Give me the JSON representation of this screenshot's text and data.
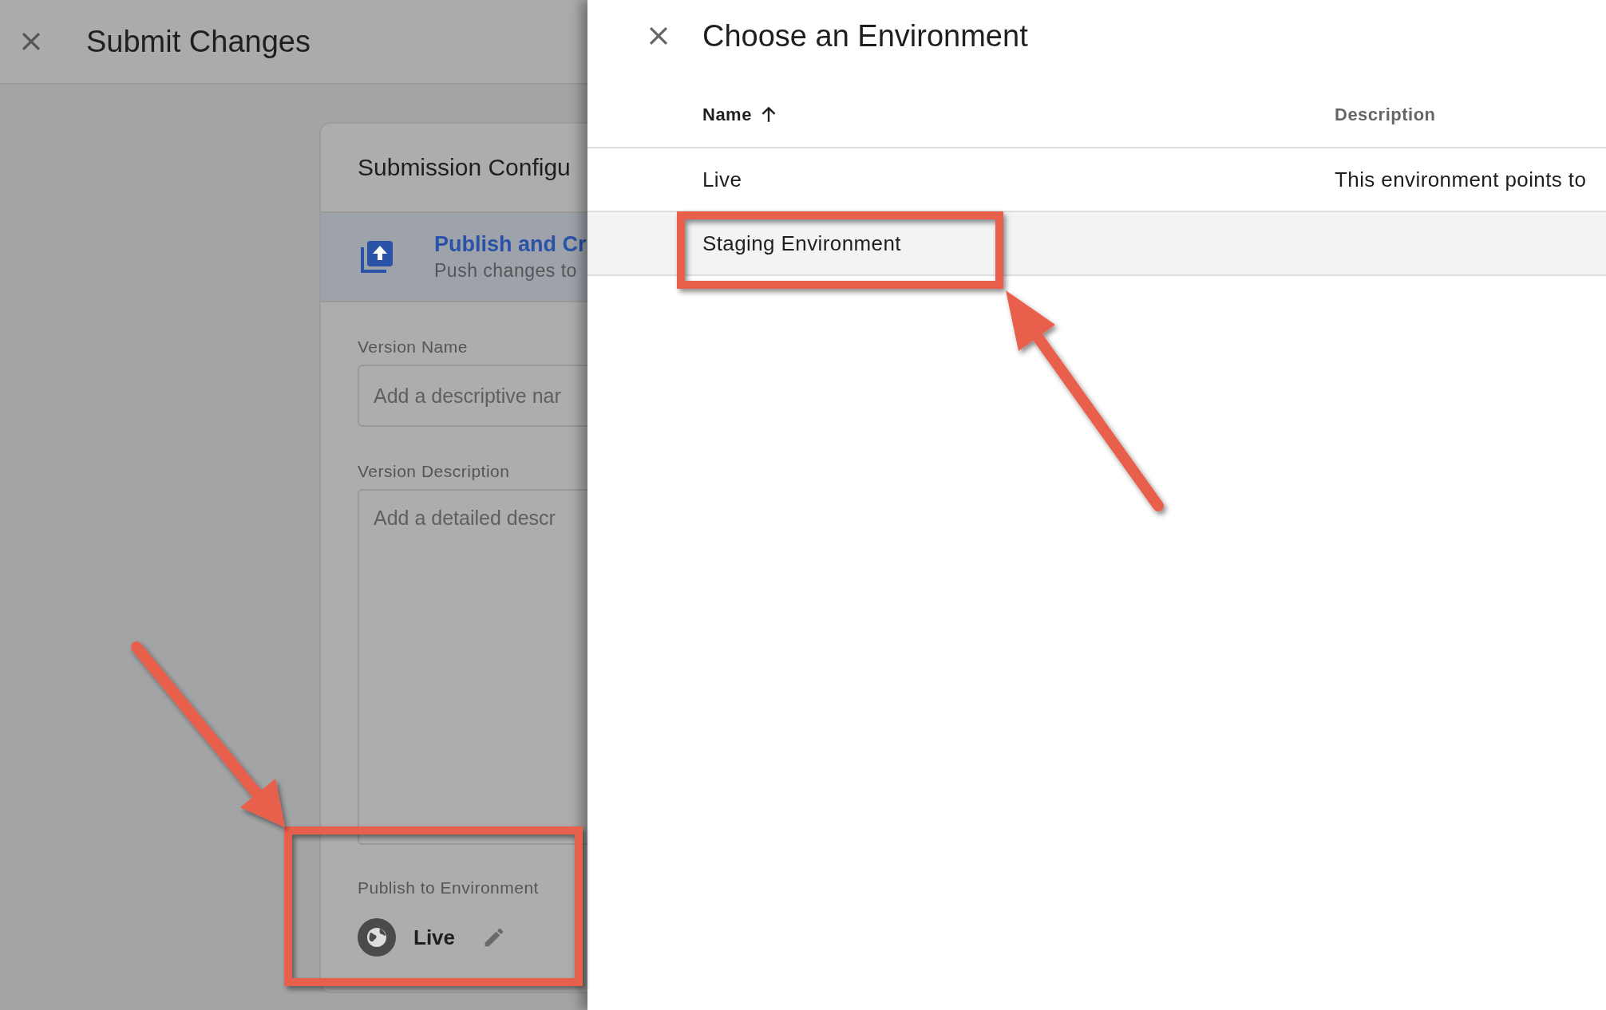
{
  "background_page": {
    "title": "Submit Changes",
    "card": {
      "title": "Submission Configu",
      "option": {
        "title": "Publish and Cr",
        "subtitle": "Push changes to",
        "selected": true
      },
      "fields": [
        {
          "kind": "input",
          "label": "Version Name",
          "placeholder": "Add a descriptive nar"
        },
        {
          "kind": "textarea",
          "label": "Version Description",
          "placeholder": "Add a detailed descr"
        }
      ],
      "environment": {
        "label": "Publish to Environment",
        "value": "Live"
      }
    }
  },
  "environment_panel": {
    "title": "Choose an Environment",
    "columns": [
      {
        "label": "Name",
        "sorted": true
      },
      {
        "label": "Description",
        "sorted": false
      }
    ],
    "rows": [
      {
        "name": "Live",
        "description": "This environment points to",
        "selected": false
      },
      {
        "name": "Staging Environment",
        "selected": true
      }
    ]
  }
}
